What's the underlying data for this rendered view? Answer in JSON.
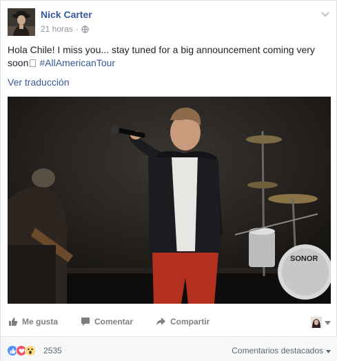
{
  "post": {
    "author": "Nick Carter",
    "timestamp": "21 horas",
    "separator": "·",
    "privacy_icon": "globe-icon",
    "text_line1": "Hola Chile! I miss you... stay tuned for a big announcement coming very",
    "text_line2": "soon",
    "hashtag": "#AllAmericanTour",
    "translate_link": "Ver traducción",
    "options_icon": "chevron-down-icon"
  },
  "actions": {
    "like_label": "Me gusta",
    "comment_label": "Comentar",
    "share_label": "Compartir"
  },
  "footer": {
    "reaction_icons": [
      "like-icon",
      "love-icon",
      "wow-icon"
    ],
    "reaction_count": "2535",
    "comment_ranking": "Comentarios destacados"
  },
  "colors": {
    "link": "#365899",
    "like_blue": "#5890ff",
    "love_red": "#f25268",
    "wow_yellow": "#ffd972"
  }
}
